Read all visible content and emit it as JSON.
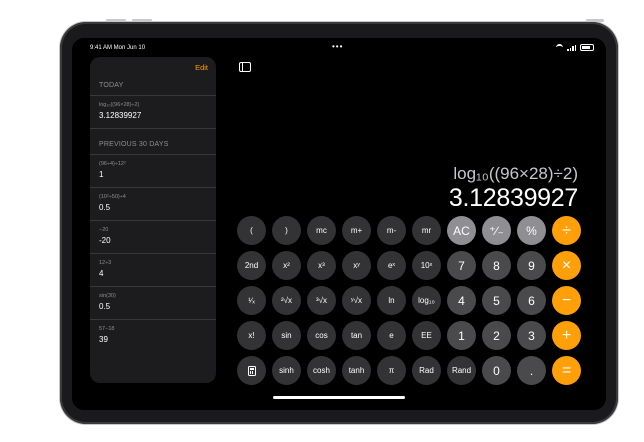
{
  "status_bar": {
    "time": "9:41 AM  Mon Jun 10"
  },
  "sidebar": {
    "edit_label": "Edit",
    "today_header": "TODAY",
    "today_items": [
      {
        "expr": "log₁₀((96×28)÷2)",
        "result": "3.12839927"
      }
    ],
    "previous_header": "PREVIOUS 30 DAYS",
    "previous_items": [
      {
        "expr": "(96÷4)÷12²",
        "result": "1"
      },
      {
        "expr": "(10²÷50)÷4",
        "result": "0.5"
      },
      {
        "expr": "−20",
        "result": "-20"
      },
      {
        "expr": "12÷3",
        "result": "4"
      },
      {
        "expr": "sin(30)",
        "result": "0.5"
      },
      {
        "expr": "57−18",
        "result": "39"
      }
    ]
  },
  "display": {
    "expression": "log₁₀((96×28)÷2)",
    "result": "3.12839927"
  },
  "keypad": {
    "row1": [
      "(",
      ")",
      "mc",
      "m+",
      "m-",
      "mr",
      "AC",
      "⁺∕₋",
      "%",
      "÷"
    ],
    "row2": [
      "2nd",
      "x²",
      "x³",
      "xʸ",
      "eˣ",
      "10ˣ",
      "7",
      "8",
      "9",
      "×"
    ],
    "row3": [
      "¹∕ₓ",
      "²√x",
      "³√x",
      "ʸ√x",
      "ln",
      "log₁₀",
      "4",
      "5",
      "6",
      "−"
    ],
    "row4": [
      "x!",
      "sin",
      "cos",
      "tan",
      "e",
      "EE",
      "1",
      "2",
      "3",
      "+"
    ],
    "row5": [
      "calculator-icon",
      "sinh",
      "cosh",
      "tanh",
      "π",
      "Rad",
      "Rand",
      "0",
      ".",
      "="
    ]
  },
  "colors": {
    "operator": "#ff9f0a",
    "function_key": "#8e8e93",
    "digit_key": "#4a4a4d",
    "scientific_key": "#333335",
    "background": "#000000"
  }
}
